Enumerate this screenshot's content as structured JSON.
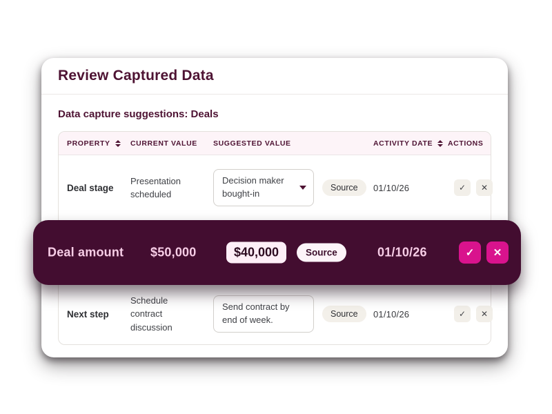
{
  "modal": {
    "title": "Review Captured Data",
    "subtitle": "Data capture suggestions: Deals"
  },
  "table": {
    "headers": {
      "property": "PROPERTY",
      "current_value": "CURRENT VALUE",
      "suggested_value": "SUGGESTED VALUE",
      "activity_date": "ACTIVITY DATE",
      "actions": "ACTIONS"
    },
    "rows": [
      {
        "property": "Deal stage",
        "current_value": "Presentation scheduled",
        "suggested_value": "Decision maker bought-in",
        "control": "dropdown",
        "source": "Source",
        "activity_date": "01/10/26",
        "highlighted": false
      },
      {
        "property": "Deal amount",
        "current_value": "$50,000",
        "suggested_value": "$40,000",
        "control": "chip",
        "source": "Source",
        "activity_date": "01/10/26",
        "highlighted": true
      },
      {
        "property": "Next step",
        "current_value": "Schedule contract discussion",
        "suggested_value": "Send contract by end of week.",
        "control": "textbox",
        "source": "Source",
        "activity_date": "01/10/26",
        "highlighted": false
      }
    ]
  },
  "icons": {
    "accept": "✓",
    "reject": "✕",
    "sort": "sort-arrows",
    "caret": "dropdown-caret"
  },
  "colors": {
    "plum_dark": "#430d30",
    "plum_text": "#4e1333",
    "accent_pink": "#d9138d",
    "header_bg": "#fdf4f8",
    "banner_text": "#f7cde6",
    "chip_bg": "#fdeef7",
    "pill_bg": "#f3f0ea"
  }
}
